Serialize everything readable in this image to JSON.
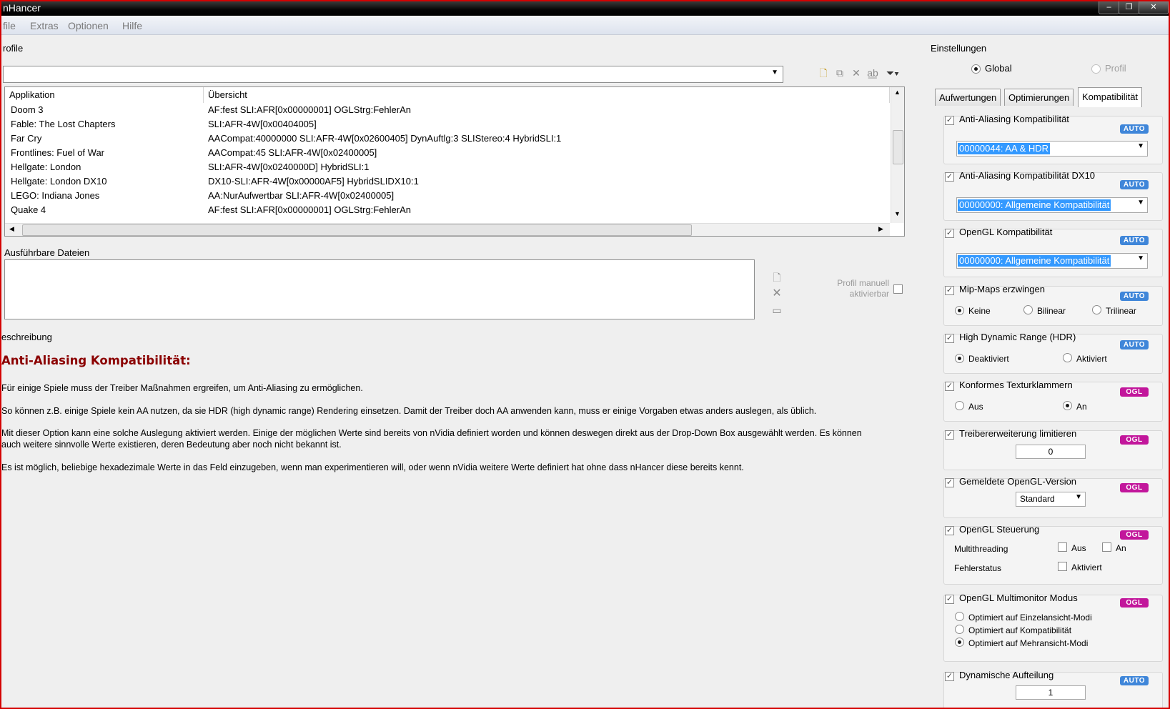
{
  "window": {
    "title": "nHancer",
    "controls": {
      "minimize": "–",
      "restore": "❐",
      "close": "✕"
    }
  },
  "menu": [
    "file",
    "Extras",
    "Optionen",
    "Hilfe"
  ],
  "profile": {
    "title": "rofile",
    "columns": [
      "Applikation",
      "Übersicht"
    ],
    "rows": [
      [
        "Doom 3",
        "AF:fest SLI:AFR[0x00000001] OGLStrg:FehlerAn"
      ],
      [
        "Fable: The Lost Chapters",
        "SLI:AFR-4W[0x00404005]"
      ],
      [
        "Far Cry",
        "AACompat:40000000 SLI:AFR-4W[0x02600405] DynAuftlg:3 SLIStereo:4 HybridSLI:1"
      ],
      [
        "Frontlines: Fuel of War",
        "AACompat:45 SLI:AFR-4W[0x02400005]"
      ],
      [
        "Hellgate: London",
        "SLI:AFR-4W[0x0240000D] HybridSLI:1"
      ],
      [
        "Hellgate: London DX10",
        "DX10-SLI:AFR-4W[0x00000AF5] HybridSLIDX10:1"
      ],
      [
        "LEGO: Indiana Jones",
        "AA:NurAufwertbar SLI:AFR-4W[0x02400005]"
      ],
      [
        "Quake 4",
        "AF:fest SLI:AFR[0x00000001] OGLStrg:FehlerAn"
      ]
    ]
  },
  "executables": {
    "title": "Ausführbare Dateien",
    "manual_line1": "Profil manuell",
    "manual_line2": "aktivierbar"
  },
  "description": {
    "title": "eschreibung",
    "heading": "Anti-Aliasing Kompatibilität:",
    "p1": "Für einige Spiele muss der Treiber Maßnahmen ergreifen, um Anti-Aliasing zu ermöglichen.",
    "p2": "So können z.B. einige Spiele kein AA nutzen, da sie HDR (high dynamic range) Rendering einsetzen. Damit der Treiber doch AA anwenden kann, muss er einige Vorgaben etwas anders auslegen, als üblich.",
    "p3a": "Mit dieser Option kann eine solche Auslegung aktiviert werden. Einige der möglichen Werte sind bereits von nVidia definiert worden und können deswegen direkt aus der Drop-Down Box ausgewählt werden. Es können",
    "p3b": "auch weitere sinnvolle Werte existieren, deren Bedeutung aber noch nicht bekannt ist.",
    "p4": "Es ist möglich, beliebige hexadezimale Werte in das Feld einzugeben, wenn man experimentieren will, oder wenn nVidia weitere Werte definiert hat ohne dass nHancer diese bereits kennt."
  },
  "settings": {
    "title": "Einstellungen",
    "scope": {
      "global": "Global",
      "profile": "Profil"
    },
    "tabs": [
      "Aufwertungen",
      "Optimierungen",
      "Kompatibilität"
    ],
    "badges": {
      "auto": "AUTO",
      "ogl": "OGL"
    },
    "colors": {
      "auto": "#3f86d9",
      "ogl": "#c2169b"
    },
    "aa_compat": {
      "label": "Anti-Aliasing Kompatibilität",
      "value": "00000044: AA & HDR"
    },
    "aa_compat_dx10": {
      "label": "Anti-Aliasing Kompatibilität DX10",
      "value": "00000000: Allgemeine Kompatibilität"
    },
    "ogl_compat": {
      "label": "OpenGL Kompatibilität",
      "value": "00000000: Allgemeine Kompatibilität"
    },
    "mipmaps": {
      "label": "Mip-Maps erzwingen",
      "opt1": "Keine",
      "opt2": "Bilinear",
      "opt3": "Trilinear"
    },
    "hdr": {
      "label": "High Dynamic Range (HDR)",
      "opt1": "Deaktiviert",
      "opt2": "Aktiviert"
    },
    "texclamp": {
      "label": "Konformes Texturklammern",
      "opt1": "Aus",
      "opt2": "An"
    },
    "ext_limit": {
      "label": "Treibererweiterung limitieren",
      "value": "0"
    },
    "ogl_version": {
      "label": "Gemeldete OpenGL-Version",
      "value": "Standard"
    },
    "ogl_control": {
      "label": "OpenGL Steuerung",
      "multithreading": "Multithreading",
      "aus": "Aus",
      "an": "An",
      "fehlerstatus": "Fehlerstatus",
      "aktiviert": "Aktiviert"
    },
    "multimonitor": {
      "label": "OpenGL Multimonitor Modus",
      "opt1": "Optimiert auf Einzelansicht-Modi",
      "opt2": "Optimiert auf Kompatibilität",
      "opt3": "Optimiert auf Mehransicht-Modi"
    },
    "dyn_split": {
      "label": "Dynamische Aufteilung",
      "value": "1"
    }
  }
}
